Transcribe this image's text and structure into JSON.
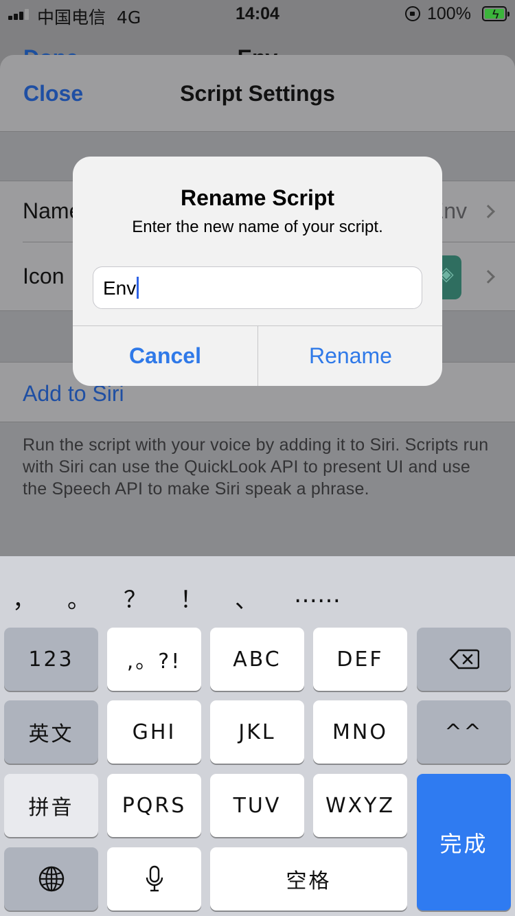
{
  "status_bar": {
    "carrier": "中国电信",
    "network": "4G",
    "time": "14:04",
    "battery_percent": "100%"
  },
  "background_sheet": {
    "left_button": "Done",
    "title": "Env"
  },
  "settings": {
    "close_label": "Close",
    "title": "Script Settings",
    "rows": [
      {
        "label": "Name",
        "value": "Env"
      },
      {
        "label": "Icon"
      }
    ],
    "add_to_siri": "Add to Siri",
    "footer": "Run the script with your voice by adding it to Siri. Scripts run with Siri can use the QuickLook API to present UI and use the Speech API to make Siri speak a phrase."
  },
  "alert": {
    "title": "Rename Script",
    "message": "Enter the new name of your script.",
    "input_value": "Env",
    "cancel_label": "Cancel",
    "rename_label": "Rename"
  },
  "keyboard": {
    "candidates": [
      "，",
      "。",
      "？",
      "！",
      "、",
      "……"
    ],
    "row1": [
      "123",
      ",。?!",
      "ABC",
      "DEF"
    ],
    "row2": [
      "英文",
      "GHI",
      "JKL",
      "MNO",
      "^^"
    ],
    "row3": [
      "拼音",
      "PQRS",
      "TUV",
      "WXYZ"
    ],
    "done_label": "完成",
    "space_label": "空格"
  },
  "colors": {
    "accent": "#2f79e8",
    "done_key": "#2f7bf1",
    "battery": "#3bb43b"
  }
}
